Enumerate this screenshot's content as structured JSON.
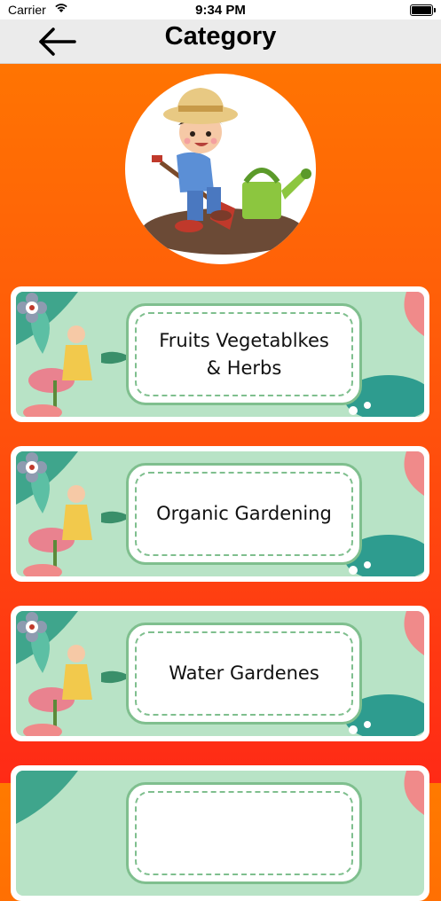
{
  "status_bar": {
    "carrier": "Carrier",
    "time": "9:34 PM"
  },
  "nav": {
    "title": "Category",
    "back_icon": "arrow-left-icon"
  },
  "hero": {
    "image": "gardener-boy-with-watering-can"
  },
  "categories": [
    {
      "label": "Fruits Vegetablkes\n& Herbs"
    },
    {
      "label": "Organic Gardening"
    },
    {
      "label": "Water Gardenes"
    },
    {
      "label": ""
    }
  ],
  "colors": {
    "gradient_top": "#ff7a00",
    "gradient_bottom": "#ff2a16",
    "nav_bg": "#ebebeb",
    "card_border": "#7fbf8e"
  }
}
